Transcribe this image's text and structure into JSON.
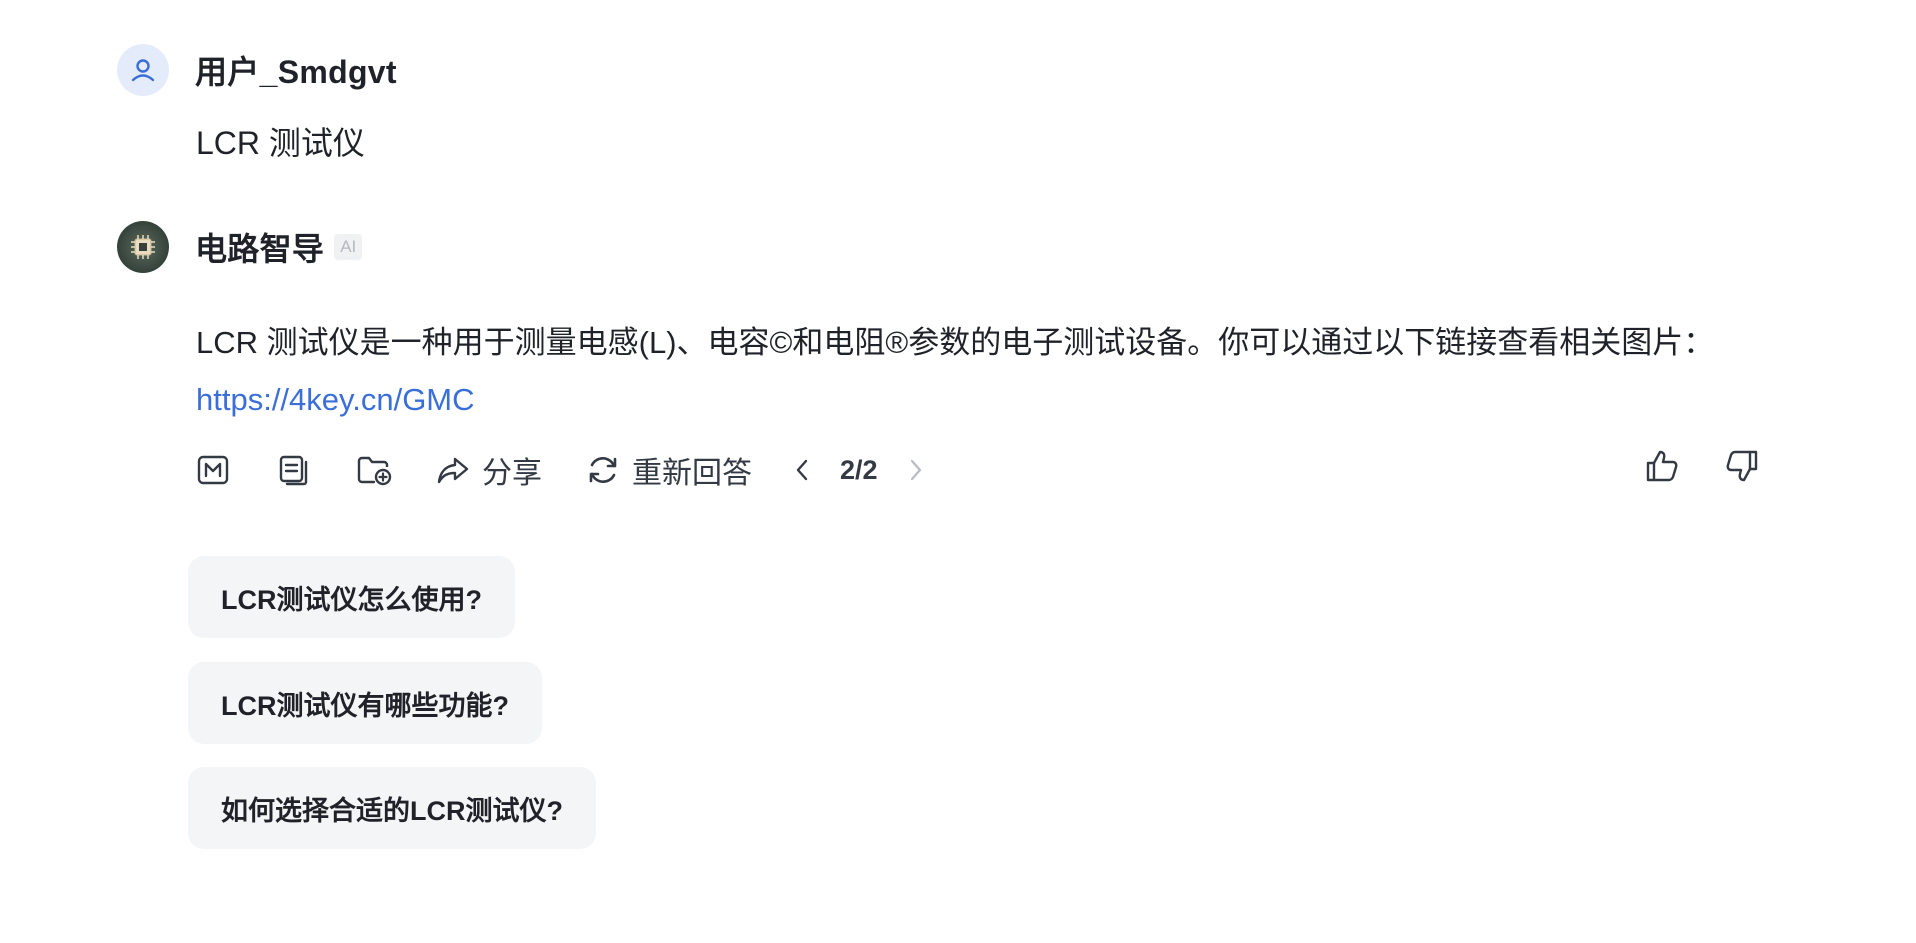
{
  "user_message": {
    "username": "用户_Smdgvt",
    "avatar_icon": "user-icon",
    "text": "LCR 测试仪"
  },
  "bot_message": {
    "name": "电路智导",
    "badge": "AI",
    "avatar_icon": "circuit-chip-avatar",
    "answer_text": "LCR 测试仪是一种用于测量电感(L)、电容©和电阻®参数的电子测试设备。你可以通过以下链接查看相关图片：",
    "link": "https://4key.cn/GMC"
  },
  "toolbar": {
    "icons": [
      "markdown-icon",
      "copy-icon",
      "add-to-folder-icon"
    ],
    "share_label": "分享",
    "regenerate_label": "重新回答",
    "page_indicator": "2/2",
    "accent_link_color": "#3b6fd8"
  },
  "suggestions": [
    "LCR测试仪怎么使用?",
    "LCR测试仪有哪些功能?",
    "如何选择合适的LCR测试仪?"
  ]
}
